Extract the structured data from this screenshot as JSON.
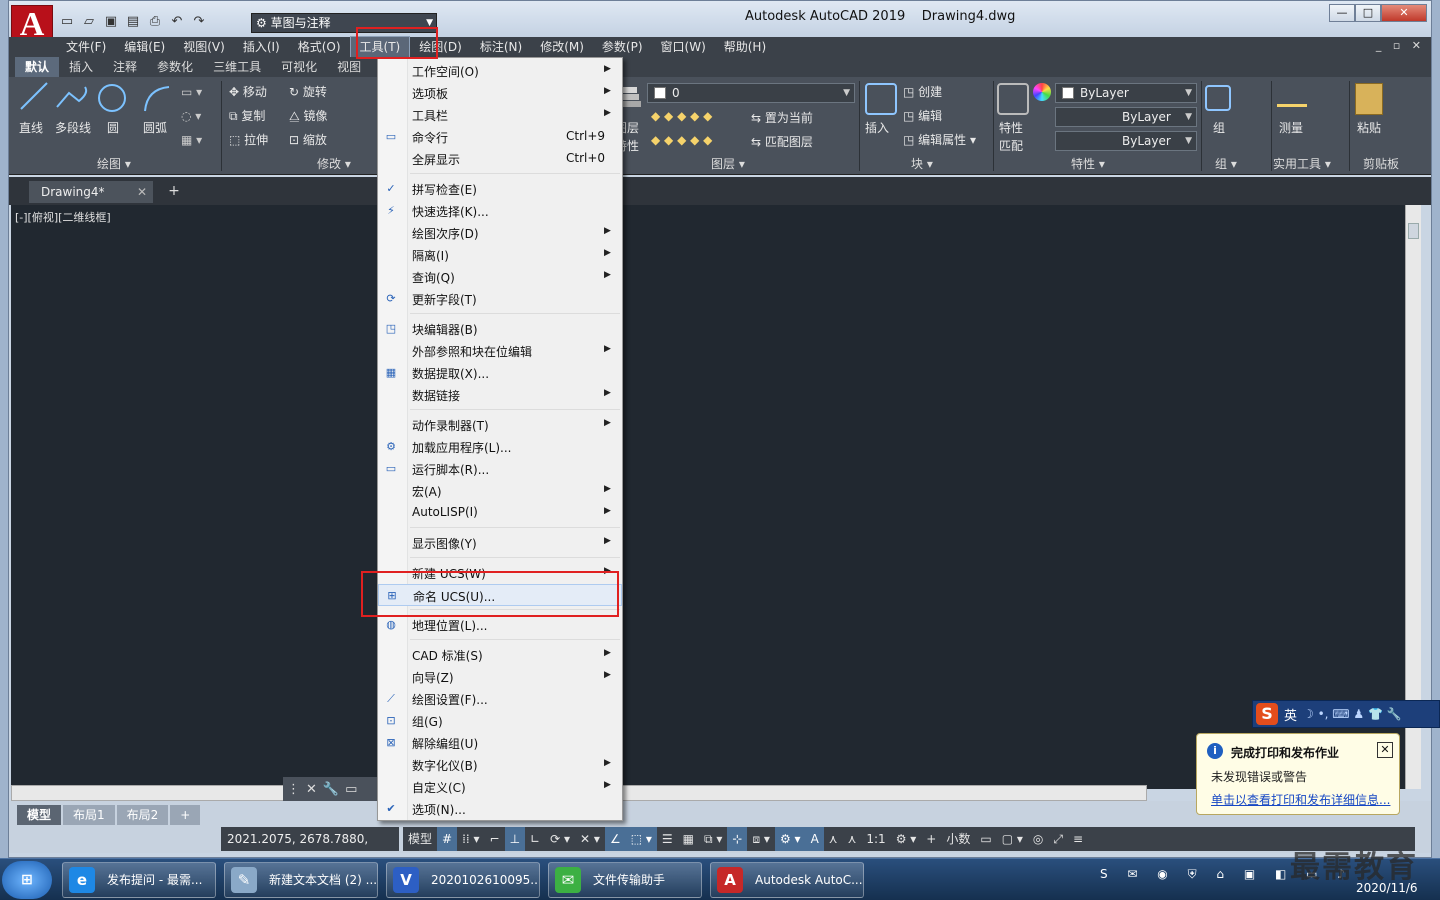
{
  "app": {
    "workspace": "草图与注释",
    "title": "Autodesk AutoCAD 2019",
    "document": "Drawing4.dwg"
  },
  "menubar": [
    "文件(F)",
    "编辑(E)",
    "视图(V)",
    "插入(I)",
    "格式(O)",
    "工具(T)",
    "绘图(D)",
    "标注(N)",
    "修改(M)",
    "参数(P)",
    "窗口(W)",
    "帮助(H)"
  ],
  "ribbon_tabs": [
    "默认",
    "插入",
    "注释",
    "参数化",
    "三维工具",
    "可视化",
    "视图"
  ],
  "ribbon": {
    "draw": {
      "line": "直线",
      "polyline": "多段线",
      "circle": "圆",
      "arc": "圆弧",
      "panel": "绘图"
    },
    "modify": {
      "move": "移动",
      "rotate": "旋转",
      "copy": "复制",
      "mirror": "镜像",
      "stretch": "拉伸",
      "scale": "缩放",
      "panel": "修改"
    },
    "layers": {
      "props": "图层",
      "props2": "特性",
      "current": "置为当前",
      "match": "匹配图层",
      "layer_value": "0",
      "panel": "图层"
    },
    "block": {
      "insert": "插入",
      "create": "创建",
      "edit": "编辑",
      "edit_attr": "编辑属性",
      "panel": "块"
    },
    "properties": {
      "match": "特性",
      "match2": "匹配",
      "color": "ByLayer",
      "linetype": "ByLayer",
      "lineweight": "ByLayer",
      "panel": "特性"
    },
    "groups": {
      "group": "组",
      "panel": "组"
    },
    "utilities": {
      "measure": "测量",
      "panel": "实用工具"
    },
    "clipboard": {
      "paste": "粘贴",
      "panel": "剪贴板"
    }
  },
  "doc_tab": "Drawing4*",
  "viewport_label": "[-][俯视][二维线框]",
  "layout_tabs": [
    "模型",
    "布局1",
    "布局2"
  ],
  "coords": "2021.2075, 2678.7880, 0.0000",
  "status": {
    "model": "模型",
    "scale": "1:1",
    "units": "小数"
  },
  "tools_menu": [
    {
      "label": "工作空间(O)",
      "arrow": true
    },
    {
      "label": "选项板",
      "arrow": true
    },
    {
      "label": "工具栏",
      "arrow": true
    },
    {
      "label": "命令行",
      "shortcut": "Ctrl+9",
      "icon": "command-line-icon"
    },
    {
      "label": "全屏显示",
      "shortcut": "Ctrl+0"
    },
    {
      "sep": true
    },
    {
      "label": "拼写检查(E)",
      "icon": "spell-check-icon"
    },
    {
      "label": "快速选择(K)...",
      "icon": "quick-select-icon"
    },
    {
      "label": "绘图次序(D)",
      "arrow": true
    },
    {
      "label": "隔离(I)",
      "arrow": true
    },
    {
      "label": "查询(Q)",
      "arrow": true
    },
    {
      "label": "更新字段(T)",
      "icon": "update-field-icon"
    },
    {
      "sep": true
    },
    {
      "label": "块编辑器(B)",
      "icon": "block-editor-icon"
    },
    {
      "label": "外部参照和块在位编辑",
      "arrow": true
    },
    {
      "label": "数据提取(X)...",
      "icon": "data-extract-icon"
    },
    {
      "label": "数据链接",
      "arrow": true
    },
    {
      "sep": true
    },
    {
      "label": "动作录制器(T)",
      "arrow": true
    },
    {
      "label": "加载应用程序(L)...",
      "icon": "load-app-icon"
    },
    {
      "label": "运行脚本(R)...",
      "icon": "run-script-icon"
    },
    {
      "label": "宏(A)",
      "arrow": true
    },
    {
      "label": "AutoLISP(I)",
      "arrow": true
    },
    {
      "sep": true
    },
    {
      "label": "显示图像(Y)",
      "arrow": true
    },
    {
      "sep": true
    },
    {
      "label": "新建 UCS(W)",
      "arrow": true
    },
    {
      "label": "命名 UCS(U)...",
      "icon": "named-ucs-icon",
      "highlight": true
    },
    {
      "sep": true
    },
    {
      "label": "地理位置(L)...",
      "icon": "globe-icon"
    },
    {
      "sep": true
    },
    {
      "label": "CAD 标准(S)",
      "arrow": true
    },
    {
      "label": "向导(Z)",
      "arrow": true
    },
    {
      "label": "绘图设置(F)...",
      "icon": "drafting-settings-icon"
    },
    {
      "label": "组(G)",
      "icon": "group-icon"
    },
    {
      "label": "解除编组(U)",
      "icon": "ungroup-icon"
    },
    {
      "label": "数字化仪(B)",
      "arrow": true
    },
    {
      "label": "自定义(C)",
      "arrow": true
    },
    {
      "label": "选项(N)...",
      "icon": "options-check-icon"
    }
  ],
  "ime": {
    "mode": "英"
  },
  "balloon": {
    "title": "完成打印和发布作业",
    "body": "未发现错误或警告",
    "link": "单击以查看打印和发布详细信息..."
  },
  "taskbar": [
    {
      "label": "发布提问 - 最需...",
      "icon": "e",
      "color": "#1e88e5"
    },
    {
      "label": "新建文本文档 (2) ...",
      "icon": "✎",
      "color": "#8aa9c8"
    },
    {
      "label": "2020102610095...",
      "icon": "V",
      "color": "#2d5fc4"
    },
    {
      "label": "文件传输助手",
      "icon": "✉",
      "color": "#3cb043"
    },
    {
      "label": "Autodesk AutoC...",
      "icon": "A",
      "color": "#c62828"
    }
  ],
  "clock": {
    "date": "2020/11/6"
  },
  "watermark": "最需教育",
  "colors": {
    "accent_red": "#e02020",
    "canvas": "#212830",
    "ribbon": "#4a515b"
  }
}
